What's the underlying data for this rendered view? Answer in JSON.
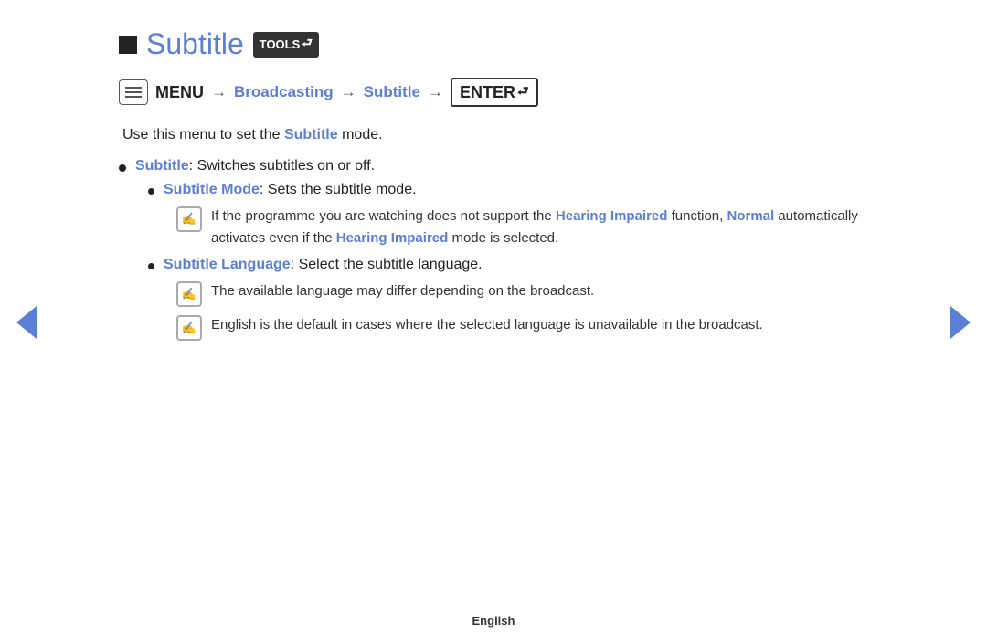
{
  "header": {
    "square_label": "",
    "title": "Subtitle",
    "tools_label": "TOOLS",
    "tools_icon": "🔧"
  },
  "breadcrumb": {
    "menu_label": "MENU",
    "arrow1": "→",
    "broadcasting": "Broadcasting",
    "arrow2": "→",
    "subtitle": "Subtitle",
    "arrow3": "→",
    "enter_label": "ENTER"
  },
  "intro": "Use this menu to set the Subtitle mode.",
  "list": [
    {
      "term": "Subtitle",
      "colon": ":",
      "description": " Switches subtitles on or off.",
      "children": [
        {
          "term": "Subtitle Mode",
          "colon": ":",
          "description": " Sets the subtitle mode.",
          "notes": [
            "If the programme you are watching does not support the Hearing Impaired function, Normal automatically activates even if the Hearing Impaired mode is selected."
          ]
        },
        {
          "term": "Subtitle Language",
          "colon": ":",
          "description": " Select the subtitle language.",
          "notes": [
            "The available language may differ depending on the broadcast.",
            "English is the default in cases where the selected language is unavailable in the broadcast."
          ]
        }
      ]
    }
  ],
  "note_icon_char": "✍",
  "nav": {
    "left_label": "left arrow",
    "right_label": "right arrow"
  },
  "footer": {
    "language": "English"
  }
}
